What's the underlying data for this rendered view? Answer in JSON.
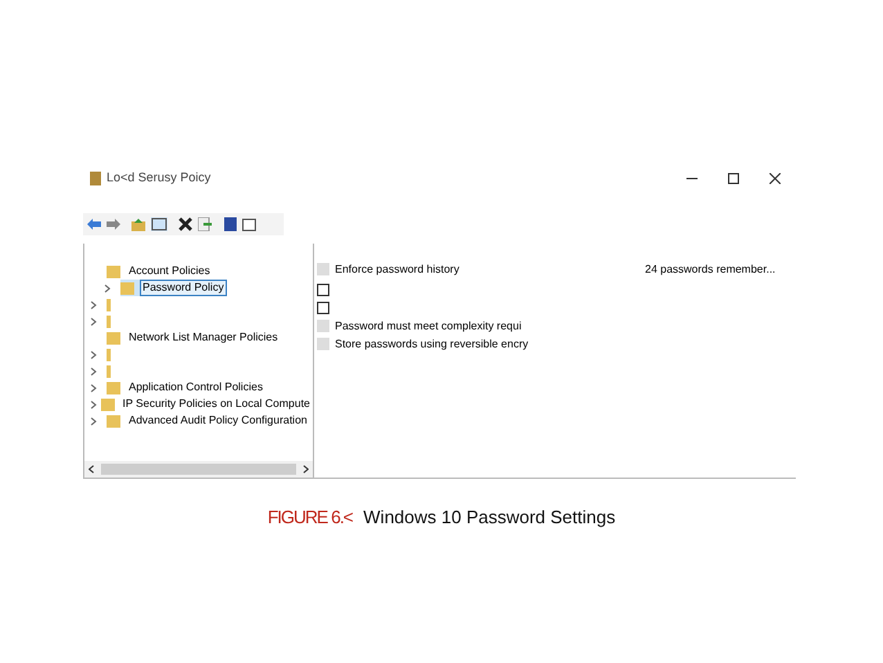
{
  "window": {
    "title": "Lo<d Serusy Poicy"
  },
  "tree": [
    {
      "label": "Account Policies",
      "expandable": false,
      "selected": false,
      "children": [
        {
          "label": "Password Policy",
          "expandable": true,
          "selected": true
        }
      ]
    },
    {
      "expandable": true,
      "selected": false
    },
    {
      "expandable": true,
      "selected": false
    },
    {
      "label": "Network List Manager Policies",
      "expandable": false,
      "selected": false
    },
    {
      "expandable": true,
      "selected": false
    },
    {
      "expandable": true,
      "selected": false
    },
    {
      "label": "Application Control Policies",
      "expandable": true,
      "selected": false
    },
    {
      "label": "IP Security Policies on Local Compute",
      "expandable": true,
      "selected": false
    },
    {
      "label": "Advanced Audit Policy Configuration",
      "expandable": true,
      "selected": false
    }
  ],
  "policies": [
    {
      "kind": "row",
      "name": "Enforce password history",
      "setting": "24 passwords remember..."
    },
    {
      "kind": "blank"
    },
    {
      "kind": "box",
      "checked": false
    },
    {
      "kind": "box",
      "checked": false
    },
    {
      "kind": "row",
      "name": "Password must meet complexity requi"
    },
    {
      "kind": "row",
      "name": "Store passwords using reversible encry"
    }
  ],
  "caption": {
    "number": "FIGURE 6.<",
    "text": "Windows 10 Password Settings"
  }
}
